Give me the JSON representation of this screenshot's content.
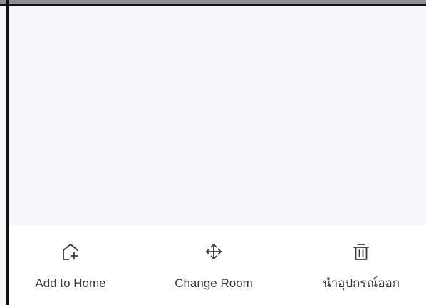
{
  "actions": [
    {
      "id": "add-to-home",
      "label": "Add to Home",
      "icon": "home-add-icon"
    },
    {
      "id": "change-room",
      "label": "Change Room",
      "icon": "move-arrows-icon"
    },
    {
      "id": "remove-device",
      "label": "นำอุปกรณ์ออก",
      "icon": "trash-icon"
    }
  ],
  "colors": {
    "background": "#f5f7fb",
    "action_bar": "#ffffff",
    "icon": "#3a3a3c",
    "top_bar": "#8e8e93"
  }
}
